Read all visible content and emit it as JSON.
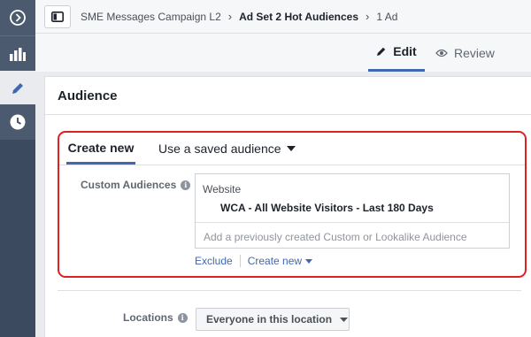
{
  "rail": {
    "items": [
      {
        "icon": "expand-circle-icon"
      },
      {
        "icon": "bar-chart-icon"
      },
      {
        "icon": "pencil-icon",
        "active": true
      },
      {
        "icon": "clock-icon"
      }
    ]
  },
  "breadcrumb": {
    "campaign": "SME Messages Campaign L2",
    "adset": "Ad Set 2 Hot Audiences",
    "ad": "1 Ad"
  },
  "mode_tabs": {
    "edit": "Edit",
    "review": "Review",
    "active": "Edit"
  },
  "audience": {
    "title": "Audience",
    "tabs": {
      "create_new": "Create new",
      "saved": "Use a saved audience"
    },
    "custom_audiences": {
      "label": "Custom Audiences",
      "group": "Website",
      "selected": "WCA - All Website Visitors - Last 180 Days",
      "placeholder": "Add a previously created Custom or Lookalike Audience"
    },
    "actions": {
      "exclude": "Exclude",
      "create_new": "Create new"
    }
  },
  "locations": {
    "label": "Locations",
    "value": "Everyone in this location"
  },
  "colors": {
    "accent": "#4267b2",
    "highlight": "#e02020",
    "rail": "#3b4a5e"
  }
}
